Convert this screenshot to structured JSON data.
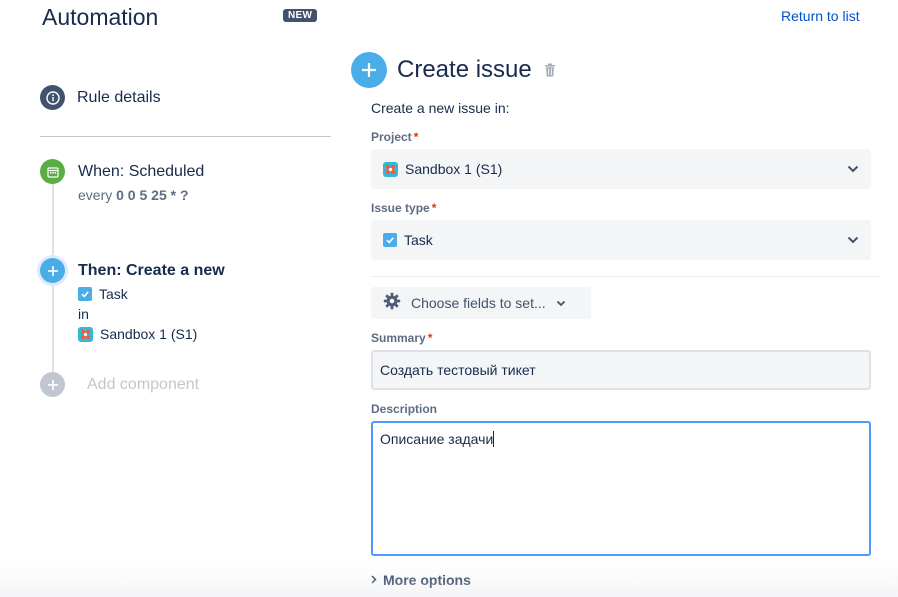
{
  "header": {
    "title": "Automation",
    "badge": "NEW",
    "return_link": "Return to list"
  },
  "sidebar": {
    "rule_details": "Rule details",
    "trigger": {
      "title": "When: Scheduled",
      "prefix": "every",
      "cron": "0 0 5 25 * ?"
    },
    "action": {
      "title": "Then: Create a new",
      "issue_type": "Task",
      "connector": "in",
      "project": "Sandbox 1 (S1)"
    },
    "add_component": "Add component"
  },
  "main": {
    "title": "Create issue",
    "intro": "Create a new issue in:",
    "project": {
      "label": "Project",
      "required": "*",
      "value": "Sandbox 1 (S1)"
    },
    "issue_type": {
      "label": "Issue type",
      "required": "*",
      "value": "Task"
    },
    "choose_fields": "Choose fields to set...",
    "summary": {
      "label": "Summary",
      "required": "*",
      "value": "Создать тестовый тикет"
    },
    "description": {
      "label": "Description",
      "value": "Описание задачи"
    },
    "more_options": "More options"
  },
  "icons": {
    "rule_details": "info-icon",
    "trigger": "calendar-icon",
    "action": "plus-icon",
    "add": "plus-icon",
    "delete": "trash-icon",
    "settings": "gear-icon",
    "dropdown": "chevron-down-icon",
    "expand": "chevron-right-icon"
  },
  "colors": {
    "accent": "#4bade8",
    "link": "#0052cc",
    "trigger": "#5aac44",
    "required": "#de350b",
    "focus": "#4c9aff"
  }
}
